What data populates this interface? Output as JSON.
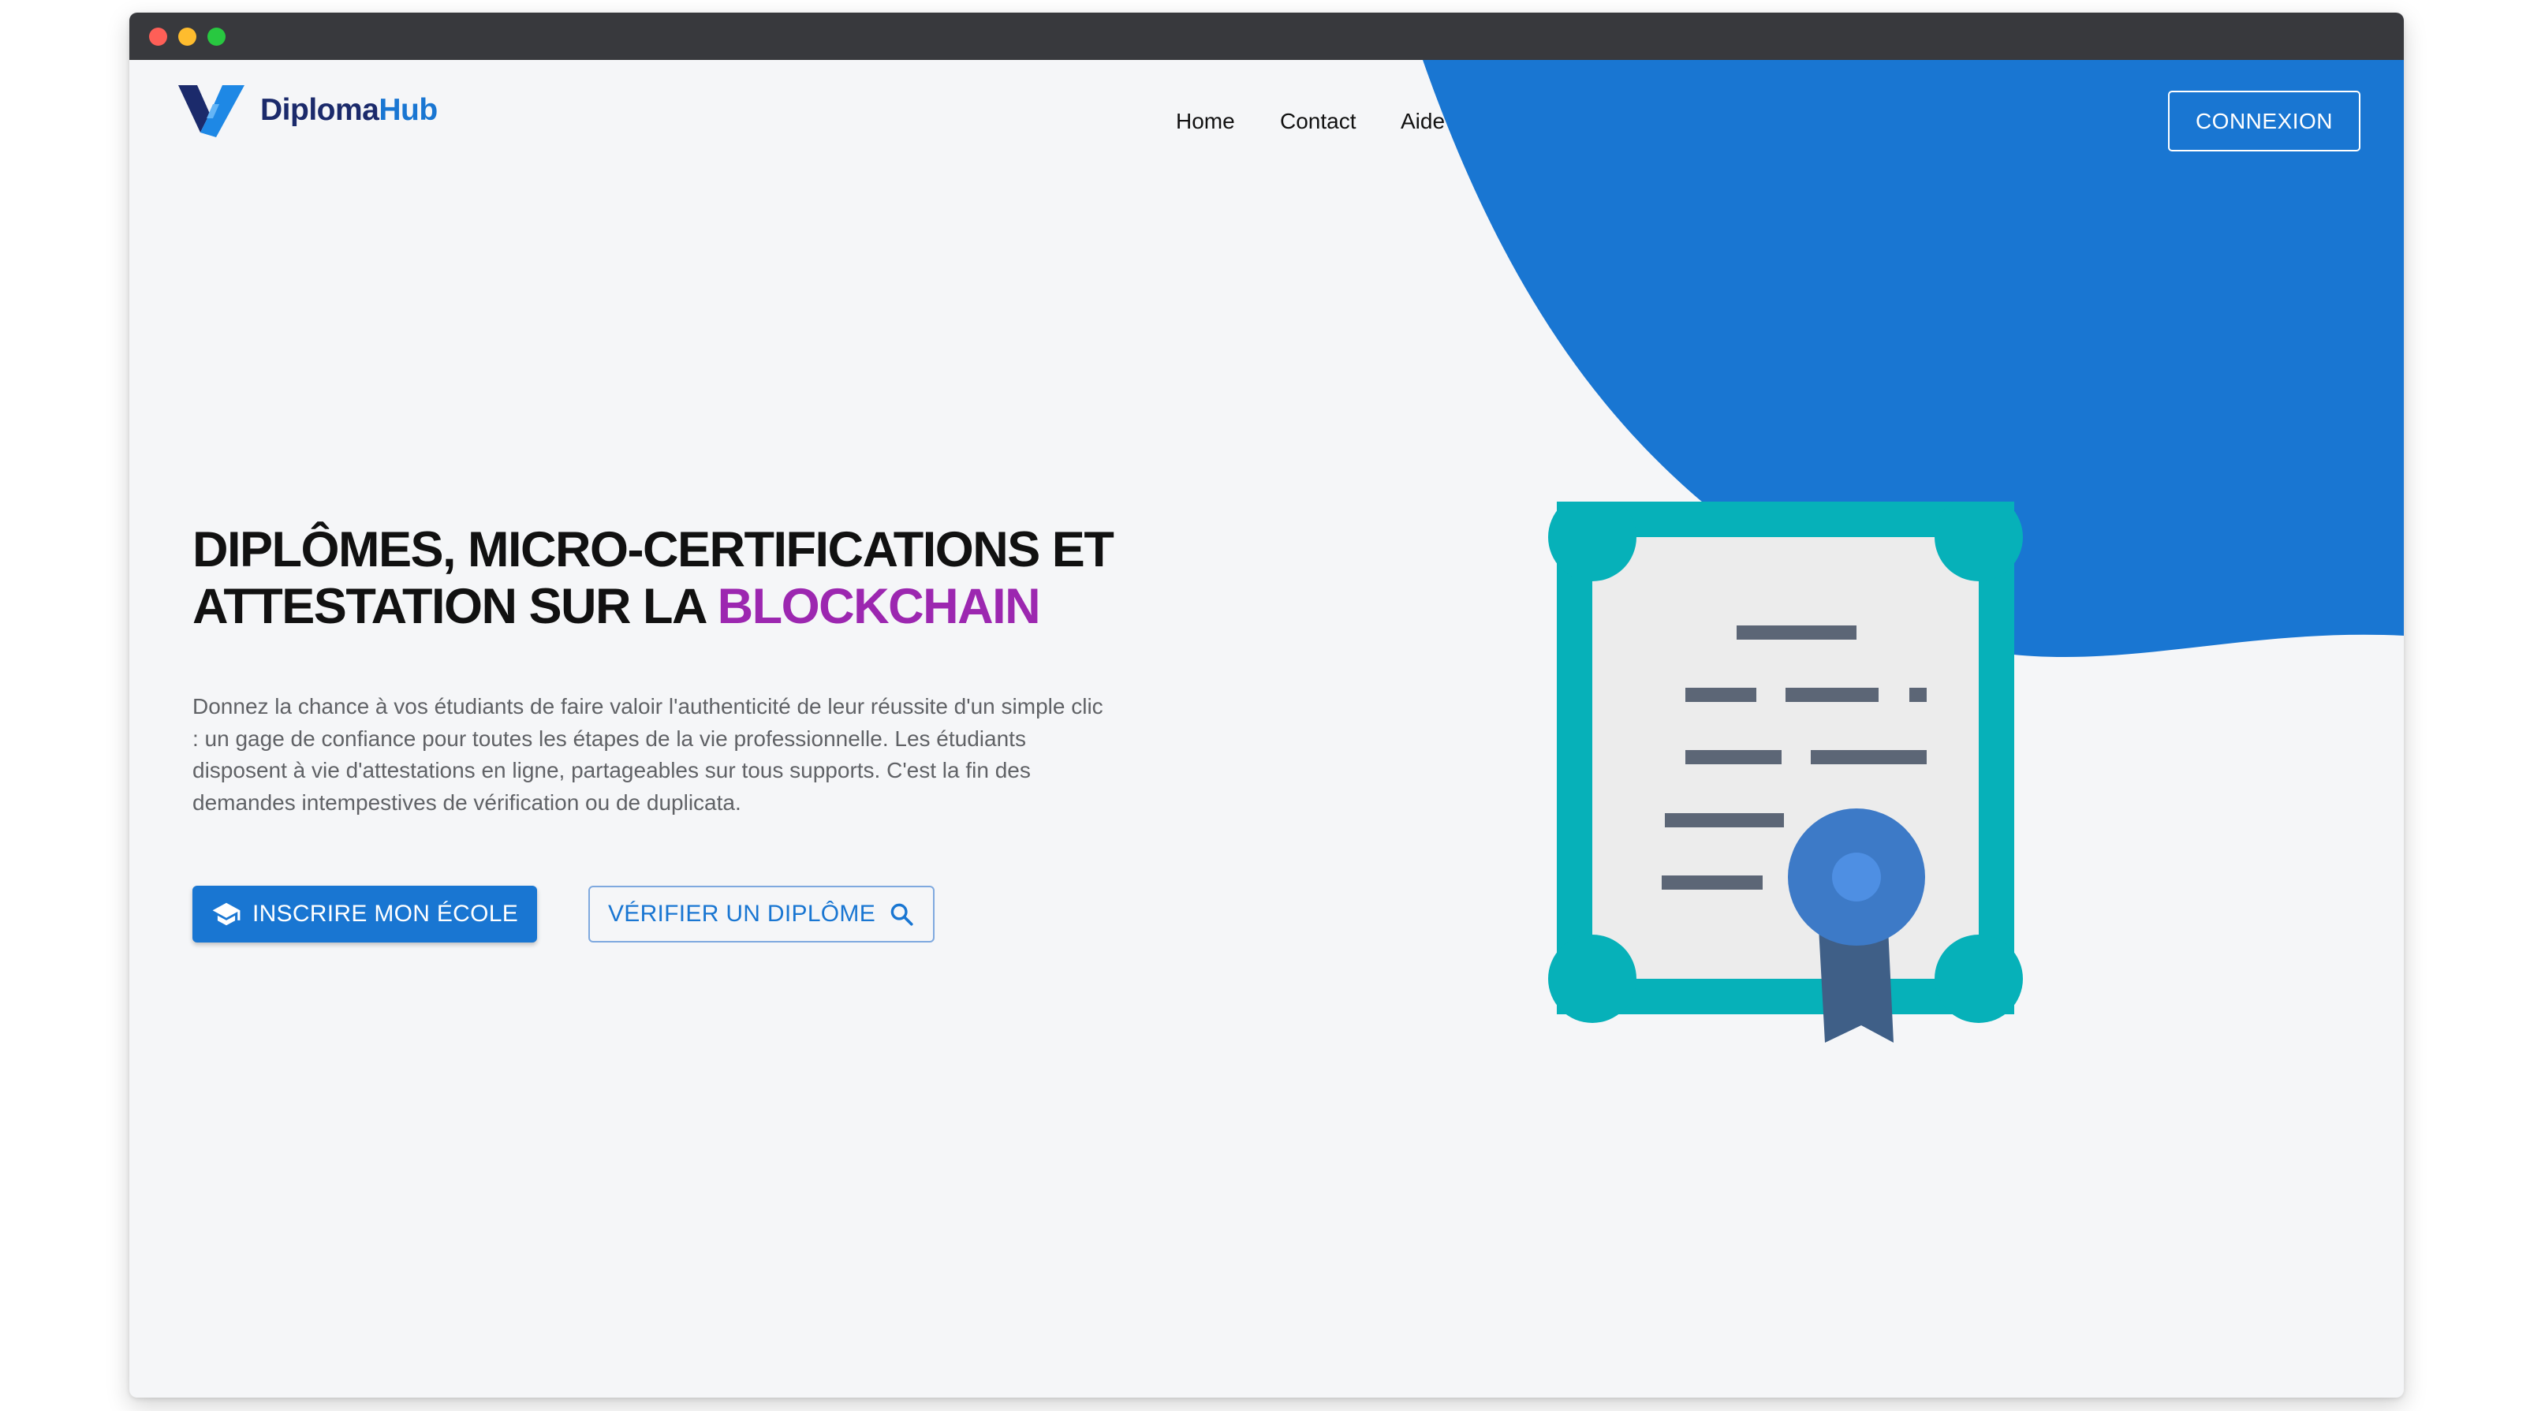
{
  "brand": {
    "name_part1": "Diploma",
    "name_part2": "Hub",
    "colors": {
      "dark": "#1b2a6b",
      "primary": "#1976d2",
      "accent": "#9c27b0",
      "teal": "#06b1b9"
    }
  },
  "nav": {
    "items": [
      {
        "label": "Home"
      },
      {
        "label": "Contact"
      },
      {
        "label": "Aide"
      }
    ],
    "login_label": "CONNEXION"
  },
  "hero": {
    "title_line1": "DIPLÔMES, MICRO-CERTIFICATIONS ET",
    "title_line2_start": "ATTESTATION SUR LA ",
    "title_accent": "BLOCKCHAIN",
    "paragraph": "Donnez la chance à vos étudiants de faire valoir l'authenticité de leur réussite d'un simple clic : un gage de confiance pour toutes les étapes de la vie professionnelle. Les étudiants disposent à vie d'attestations en ligne, partageables sur tous supports. C'est la fin des demandes intempestives de vérification ou de duplicata.",
    "cta_primary": {
      "label": "INSCRIRE MON ÉCOLE",
      "icon": "graduation-cap-icon"
    },
    "cta_secondary": {
      "label": "VÉRIFIER UN DIPLÔME",
      "icon": "search-icon"
    }
  },
  "illustration": {
    "icon": "certificate-icon"
  }
}
